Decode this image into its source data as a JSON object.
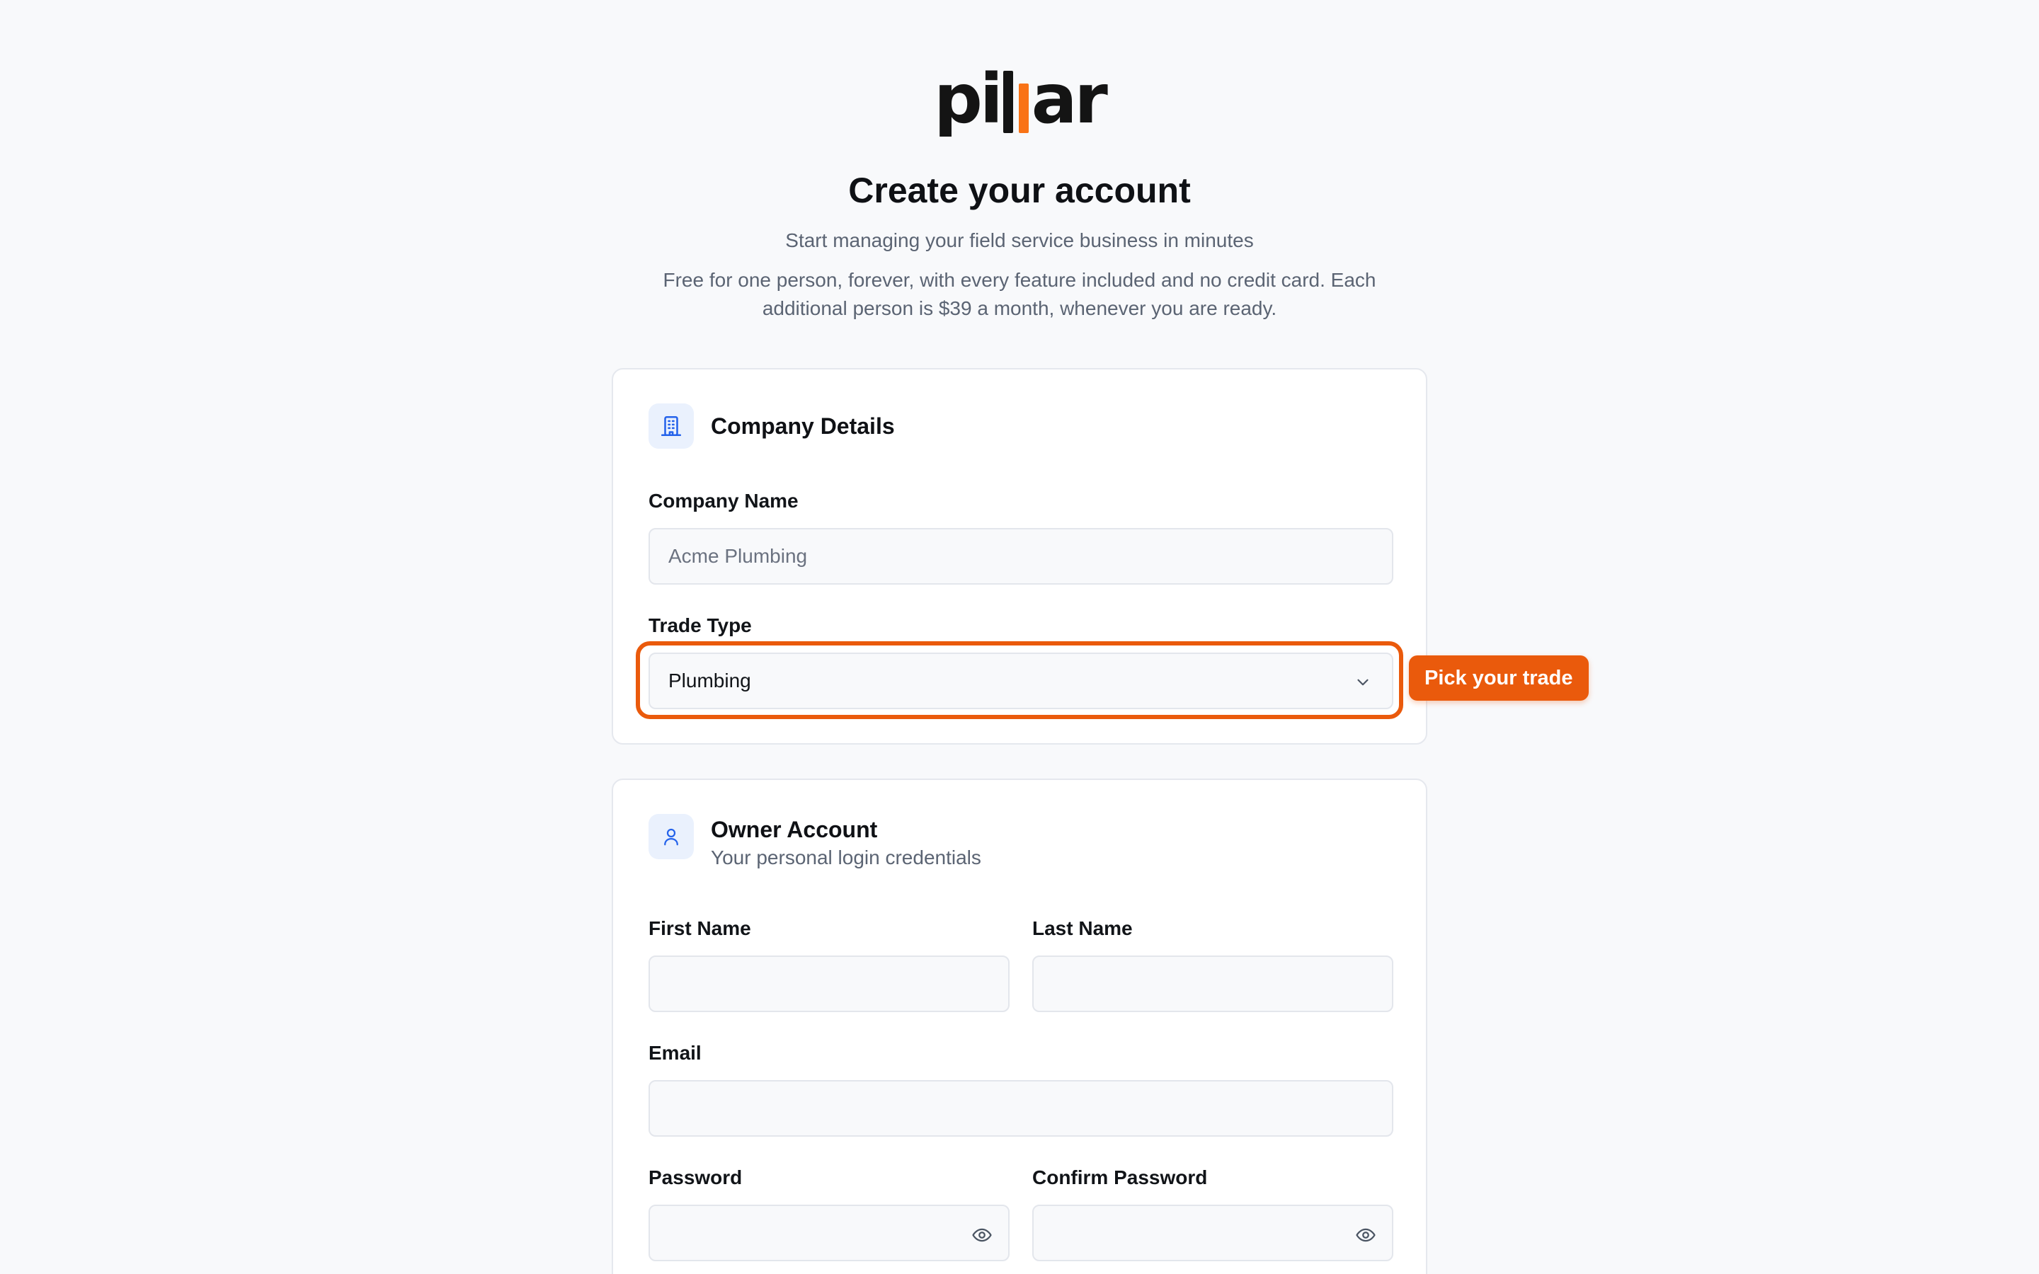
{
  "brand": {
    "name_prefix": "pi",
    "name_suffix": "ar",
    "accent": "#f97316"
  },
  "header": {
    "title": "Create your account",
    "subtitle": "Start managing your field service business in minutes",
    "note": "Free for one person, forever, with every feature included and no credit card. Each additional person is $39 a month, whenever you are ready."
  },
  "company": {
    "title": "Company Details",
    "icon": "building-icon",
    "company_name_label": "Company Name",
    "company_name_placeholder": "Acme Plumbing",
    "trade_type_label": "Trade Type",
    "trade_type_value": "Plumbing",
    "tooltip": "Pick your trade"
  },
  "owner": {
    "title": "Owner Account",
    "subtitle": "Your personal login credentials",
    "icon": "user-icon",
    "first_name_label": "First Name",
    "last_name_label": "Last Name",
    "email_label": "Email",
    "password_label": "Password",
    "confirm_password_label": "Confirm Password"
  }
}
